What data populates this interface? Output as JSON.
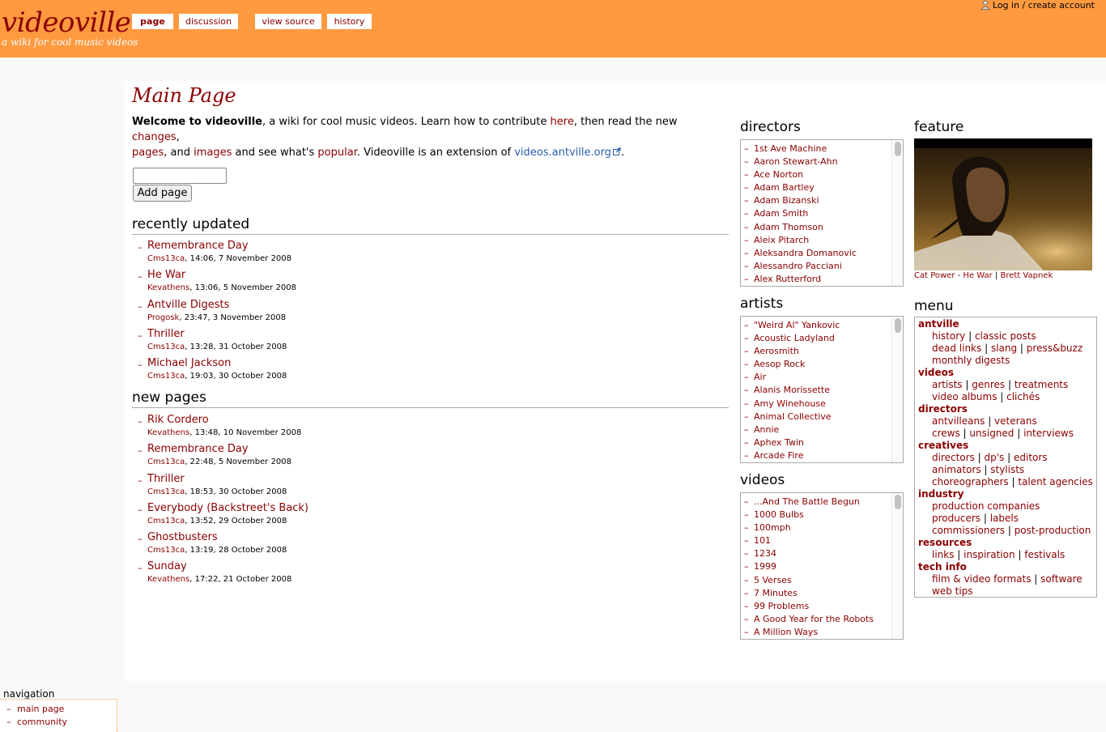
{
  "header": {
    "site_title": "videoville",
    "tagline": "a wiki for cool music videos",
    "tabs": [
      {
        "label": "page"
      },
      {
        "label": "discussion"
      },
      {
        "label": "view source"
      },
      {
        "label": "history"
      }
    ],
    "login_label": "Log in / create account"
  },
  "main": {
    "title": "Main Page",
    "intro": {
      "welcome": "Welcome to videoville",
      "t1": ", a wiki for cool music videos. Learn how to contribute ",
      "here": "here",
      "t2": ", then read the new ",
      "changes": "changes",
      "t3": ",",
      "pages": "pages",
      "t4": ", and ",
      "images": "images",
      "t5": " and see what's ",
      "popular": "popular",
      "t6": ". Videoville is an extension of ",
      "antville_link": "videos.antville.org",
      "t7": "."
    },
    "add_input_value": "",
    "add_button": "Add page",
    "recently_updated": {
      "heading": "recently updated",
      "items": [
        {
          "title": "Remembrance Day",
          "user": "Cms13ca",
          "when": ", 14:06, 7 November 2008"
        },
        {
          "title": "He War",
          "user": "Kevathens",
          "when": ", 13:06, 5 November 2008"
        },
        {
          "title": "Antville Digests",
          "user": "Progosk",
          "when": ", 23:47, 3 November 2008"
        },
        {
          "title": "Thriller",
          "user": "Cms13ca",
          "when": ", 13:28, 31 October 2008"
        },
        {
          "title": "Michael Jackson",
          "user": "Cms13ca",
          "when": ", 19:03, 30 October 2008"
        }
      ]
    },
    "new_pages": {
      "heading": "new pages",
      "items": [
        {
          "title": "Rik Cordero",
          "user": "Kevathens",
          "when": ", 13:48, 10 November 2008"
        },
        {
          "title": "Remembrance Day",
          "user": "Cms13ca",
          "when": ", 22:48, 5 November 2008"
        },
        {
          "title": "Thriller",
          "user": "Cms13ca",
          "when": ", 18:53, 30 October 2008"
        },
        {
          "title": "Everybody (Backstreet's Back)",
          "user": "Cms13ca",
          "when": ", 13:52, 29 October 2008"
        },
        {
          "title": "Ghostbusters",
          "user": "Cms13ca",
          "when": ", 13:19, 28 October 2008"
        },
        {
          "title": "Sunday",
          "user": "Kevathens",
          "when": ", 17:22, 21 October 2008"
        }
      ]
    }
  },
  "directors": {
    "heading": "directors",
    "items": [
      "1st Ave Machine",
      "Aaron Stewart-Ahn",
      "Ace Norton",
      "Adam Bartley",
      "Adam Bizanski",
      "Adam Smith",
      "Adam Thomson",
      "Aleix Pitarch",
      "Aleksandra Domanovic",
      "Alessandro Pacciani",
      "Alex Rutterford"
    ]
  },
  "artists": {
    "heading": "artists",
    "items": [
      "\"Weird Al\" Yankovic",
      "Acoustic Ladyland",
      "Aerosmith",
      "Aesop Rock",
      "Air",
      "Alanis Morissette",
      "Amy Winehouse",
      "Animal Collective",
      "Annie",
      "Aphex Twin",
      "Arcade Fire"
    ]
  },
  "videos": {
    "heading": "videos",
    "items": [
      "...And The Battle Begun",
      "1000 Bulbs",
      "100mph",
      "101",
      "1234",
      "1999",
      "5 Verses",
      "7 Minutes",
      "99 Problems",
      "A Good Year for the Robots",
      "A Million Ways"
    ]
  },
  "feature": {
    "heading": "feature",
    "artist": "Cat Power",
    "sep1": " - ",
    "song": "He War",
    "sep2": " | ",
    "director": "Brett Vapnek"
  },
  "menu": {
    "heading": "menu",
    "groups": {
      "antville": "antville",
      "videos": "videos",
      "directors": "directors",
      "creatives": "creatives",
      "industry": "industry",
      "resources": "resources",
      "tech_info": "tech info"
    },
    "links": {
      "history": "history",
      "classic_posts": "classic posts",
      "dead_links": "dead links",
      "slang": "slang",
      "press_buzz": "press&buzz",
      "monthly_digests": "monthly digests",
      "artists": "artists",
      "genres": "genres",
      "treatments": "treatments",
      "video_albums": "video albums",
      "cliches": "clichés",
      "antvilleans": "antvilleans",
      "veterans": "veterans",
      "crews": "crews",
      "unsigned": "unsigned",
      "interviews": "interviews",
      "directors": "directors",
      "dps": "dp's",
      "editors": "editors",
      "animators": "animators",
      "stylists": "stylists",
      "choreographers": "choreographers",
      "talent_agencies": "talent agencies",
      "production_companies": "production companies",
      "producers": "producers",
      "labels": "labels",
      "commissioners": "commissioners",
      "post_production": "post-production",
      "links": "links",
      "inspiration": "inspiration",
      "festivals": "festivals",
      "film_video_formats": "film & video formats",
      "software": "software",
      "web_tips": "web tips"
    },
    "sep": " | "
  },
  "navigation": {
    "heading": "navigation",
    "items": [
      "main page",
      "community"
    ]
  },
  "colors": {
    "header_bg": "#ff9a40",
    "link": "#8b0000",
    "external_link": "#2a5db0"
  }
}
